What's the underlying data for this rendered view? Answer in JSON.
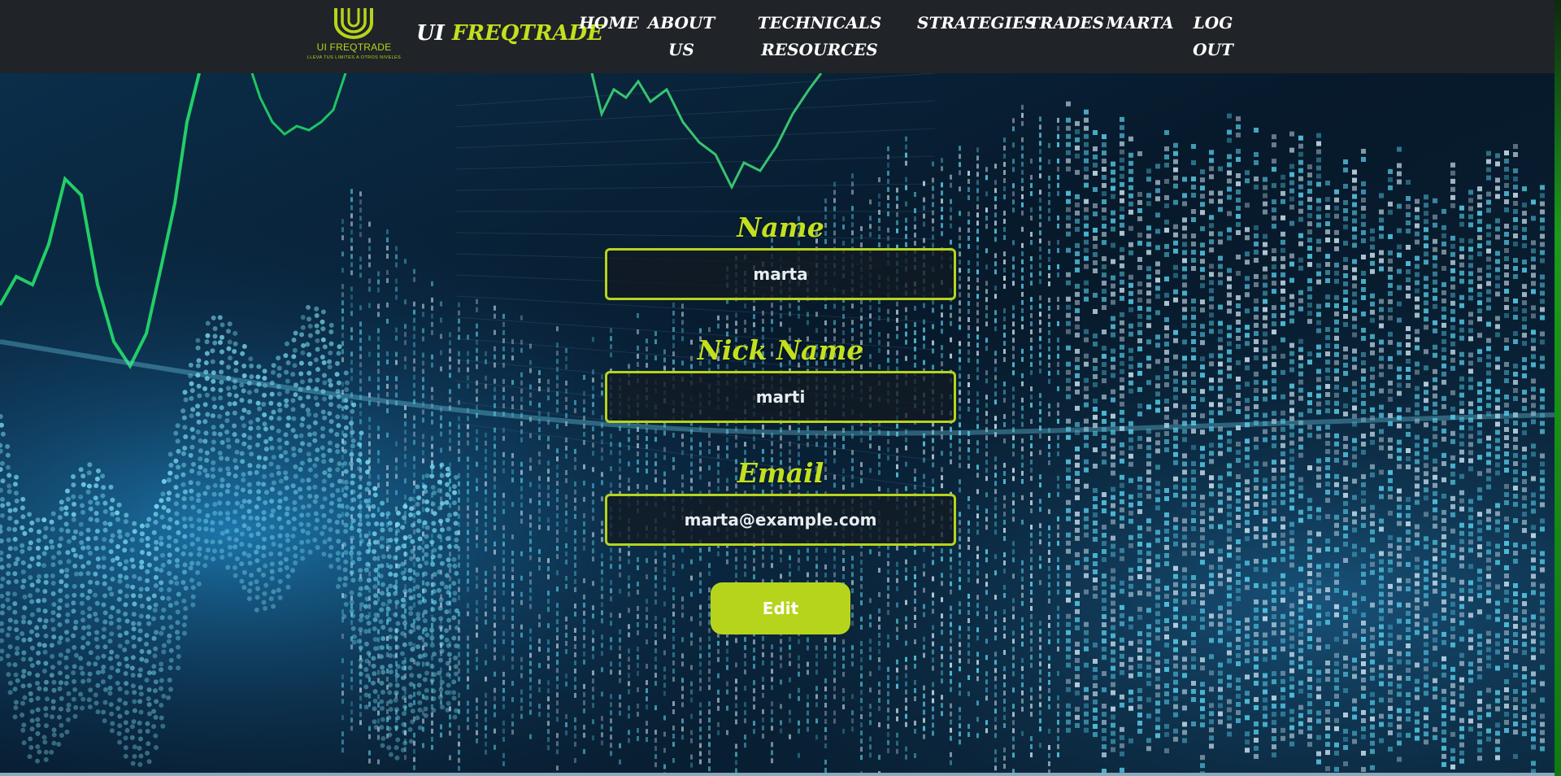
{
  "header": {
    "logo": {
      "title": "UI FREQTRADE",
      "tagline": "LLEVA TUS LIMITES A OTROS NIVELES"
    },
    "brand": {
      "part1": "UI ",
      "part2": "FREQTRADE"
    },
    "nav": {
      "home": "HOME",
      "about_line1": "ABOUT",
      "about_line2": "US",
      "technicals_line1": "TECHNICALS",
      "technicals_line2": "RESOURCES",
      "strategies": "STRATEGIES",
      "trades": "TRADES",
      "user": "MARTA",
      "logout_line1": "LOG",
      "logout_line2": "OUT"
    }
  },
  "form": {
    "name_label": "Name",
    "name_value": "marta",
    "nick_label": "Nick Name",
    "nick_value": "marti",
    "email_label": "Email",
    "email_value": "marta@example.com",
    "edit_label": "Edit"
  },
  "colors": {
    "accent": "#b6d41b",
    "header_bg": "#202327",
    "chart_green": "#25e06a",
    "chart_cyan": "#5ad4f0"
  },
  "icons": {
    "logo": "u-logo-icon"
  }
}
